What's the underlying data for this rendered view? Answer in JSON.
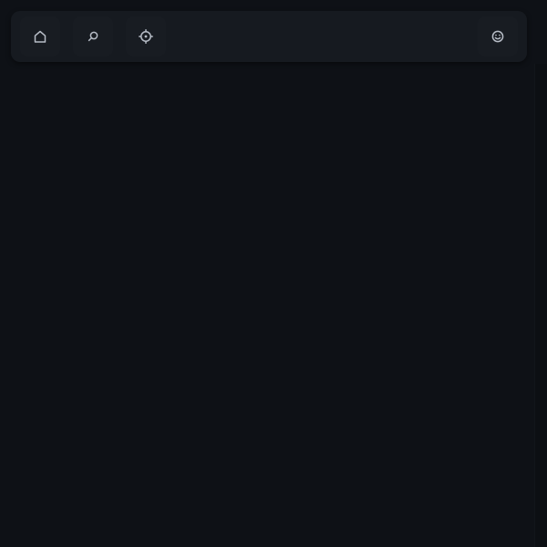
{
  "toolbar": {
    "buttons": [
      {
        "icon": "home-icon"
      },
      {
        "icon": "search-icon"
      },
      {
        "icon": "gear-icon"
      },
      {
        "icon": "smiley-icon"
      }
    ]
  },
  "colors": {
    "background": "#0e1116",
    "toolbar": "#161a20",
    "icon": "#b6bcc6"
  }
}
